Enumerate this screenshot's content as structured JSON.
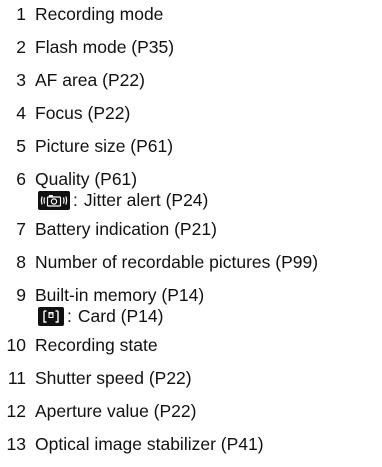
{
  "items": [
    {
      "num": "1",
      "label": "Recording mode"
    },
    {
      "num": "2",
      "label": "Flash mode (P35)"
    },
    {
      "num": "3",
      "label": "AF area (P22)"
    },
    {
      "num": "4",
      "label": "Focus (P22)"
    },
    {
      "num": "5",
      "label": "Picture size (P61)"
    },
    {
      "num": "6",
      "label": "Quality (P61)",
      "sub": {
        "icon": "jitter-alert-icon",
        "colon": ":",
        "text": "Jitter alert (P24)"
      }
    },
    {
      "num": "7",
      "label": "Battery indication (P21)"
    },
    {
      "num": "8",
      "label": "Number of recordable pictures (P99)"
    },
    {
      "num": "9",
      "label": "Built-in memory (P14)",
      "sub": {
        "icon": "card-icon",
        "colon": ":",
        "text": "Card (P14)"
      }
    },
    {
      "num": "10",
      "label": "Recording state"
    },
    {
      "num": "11",
      "label": "Shutter speed (P22)"
    },
    {
      "num": "12",
      "label": "Aperture value (P22)"
    },
    {
      "num": "13",
      "label": "Optical image stabilizer (P41)"
    }
  ]
}
